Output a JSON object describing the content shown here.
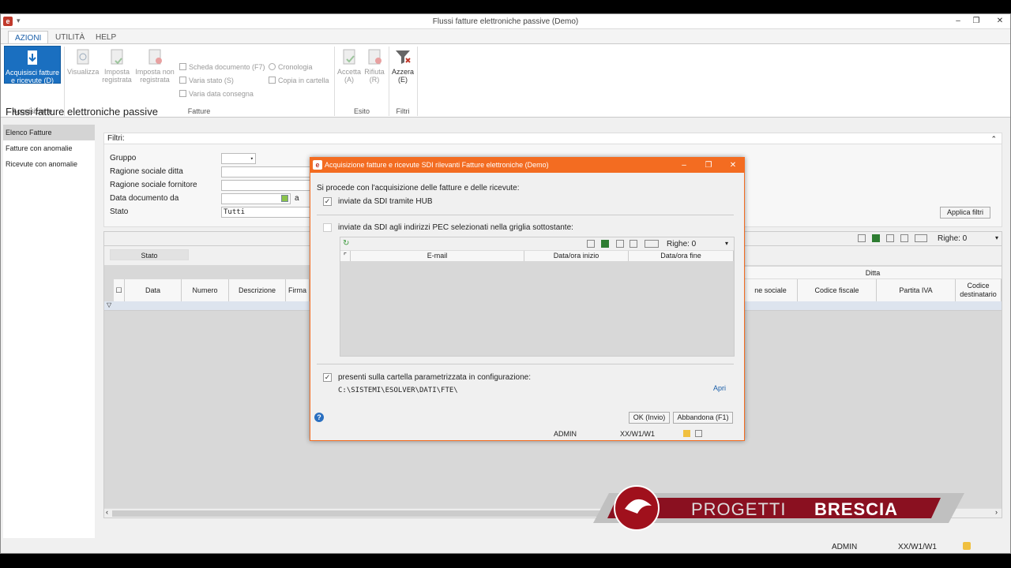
{
  "window": {
    "title": "Flussi fatture elettroniche passive  (Demo)",
    "min": "–",
    "max": "❐",
    "close": "✕"
  },
  "tabs": [
    {
      "label": "AZIONI"
    },
    {
      "label": "UTILITÀ"
    },
    {
      "label": "HELP"
    }
  ],
  "ribbon": {
    "acquisizione": {
      "btn_line1": "Acquisisci fatture",
      "btn_line2": "e ricevute (D)",
      "group": "Acquisizione"
    },
    "fatture": {
      "visualizza": "Visualizza",
      "imposta_reg_1": "Imposta",
      "imposta_reg_2": "registrata",
      "imposta_nonreg_1": "Imposta non",
      "imposta_nonreg_2": "registrata",
      "scheda": "Scheda documento (F7)",
      "varia_stato": "Varia stato (S)",
      "varia_data": "Varia data consegna",
      "cronologia": "Cronologia",
      "copia": "Copia in cartella",
      "group": "Fatture"
    },
    "esito": {
      "accetta_1": "Accetta",
      "accetta_2": "(A)",
      "rifiuta_1": "Rifiuta",
      "rifiuta_2": "(R)",
      "group": "Esito"
    },
    "filtri": {
      "azzera_1": "Azzera",
      "azzera_2": "(E)",
      "group": "Filtri"
    }
  },
  "page_title": "Flussi fatture elettroniche passive",
  "nav": [
    {
      "label": "Elenco Fatture"
    },
    {
      "label": "Fatture con anomalie"
    },
    {
      "label": "Ricevute con anomalie"
    }
  ],
  "filters": {
    "header": "Filtri:",
    "gruppo": "Gruppo",
    "ragione_ditta": "Ragione sociale ditta",
    "ragione_fornitore": "Ragione sociale fornitore",
    "data_da": "Data documento da",
    "a": "a",
    "stato": "Stato",
    "stato_value": "Tutti",
    "apply": "Applica filtri"
  },
  "grid": {
    "righe": "Righe: 0",
    "group_chip": "Stato",
    "ditta": "Ditta",
    "columns": {
      "data": "Data",
      "numero": "Numero",
      "descrizione": "Descrizione",
      "firma": "Firma",
      "ragione": "ne sociale",
      "codice_fiscale": "Codice fiscale",
      "partita_iva": "Partita IVA",
      "codice_dest_1": "Codice",
      "codice_dest_2": "destinatario"
    }
  },
  "status": {
    "user": "ADMIN",
    "path": "XX/W1/W1"
  },
  "watermark": {
    "text1": "PROGETTI",
    "text2": "BRESCIA"
  },
  "dialog": {
    "title": "Acquisizione fatture e ricevute SDI rilevanti Fatture elettroniche  (Demo)",
    "intro": "Si procede con l'acquisizione delle fatture e delle ricevute:",
    "opt1": "inviate da SDI tramite HUB",
    "opt2": "inviate da SDI agli indirizzi PEC selezionati nella griglia sottostante:",
    "righe": "Righe: 0",
    "col_email": "E-mail",
    "col_inizio": "Data/ora inizio",
    "col_fine": "Data/ora fine",
    "opt3": "presenti sulla cartella parametrizzata in configurazione:",
    "folder": "C:\\SISTEMI\\ESOLVER\\DATI\\FTE\\",
    "apri": "Apri",
    "ok": "OK (Invio)",
    "abbandona": "Abbandona (F1)",
    "user": "ADMIN",
    "path": "XX/W1/W1"
  }
}
